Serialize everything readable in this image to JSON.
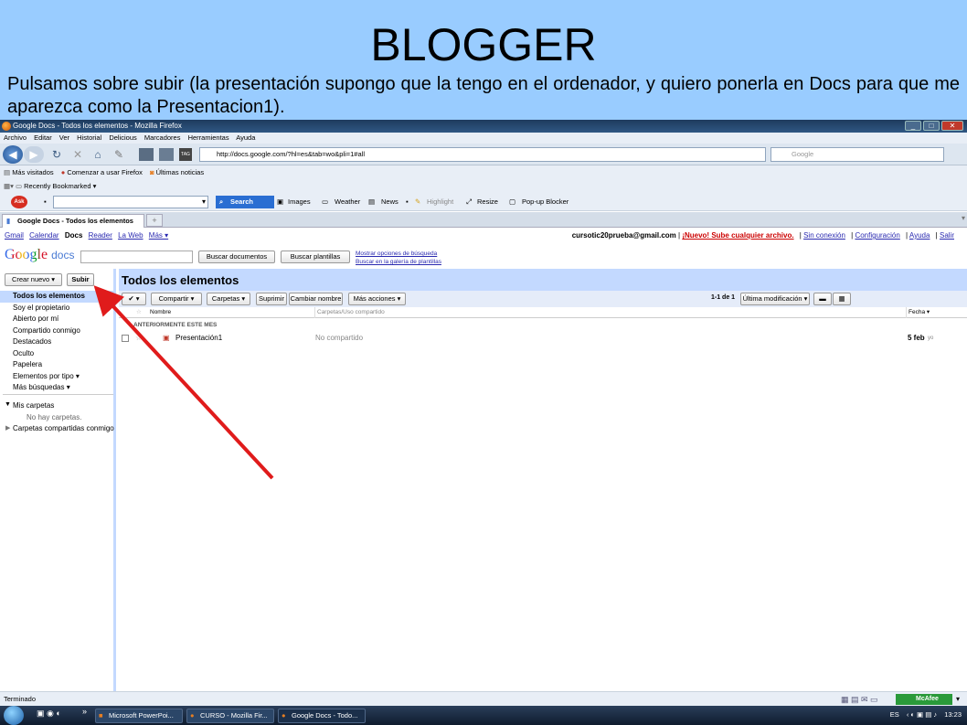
{
  "slide": {
    "title": "BLOGGER",
    "subtitle": "Pulsamos sobre subir (la presentación supongo que la tengo en el ordenador, y quiero ponerla en Docs para que me aparezca como la Presentacion1)."
  },
  "browser": {
    "window_title": "Google Docs - Todos los elementos - Mozilla Firefox",
    "menu": [
      "Archivo",
      "Editar",
      "Ver",
      "Historial",
      "Delicious",
      "Marcadores",
      "Herramientas",
      "Ayuda"
    ],
    "url": "http://docs.google.com/?hl=es&tab=wo&pli=1#all",
    "search_placeholder": "Google",
    "bookmarks": [
      "Más visitados",
      "Comenzar a usar Firefox",
      "Últimas noticias"
    ],
    "recently_bookmarked": "Recently Bookmarked",
    "ask_toolbar": {
      "search": "Search",
      "items": [
        "Images",
        "Weather",
        "News",
        "Highlight",
        "Resize",
        "Pop-up Blocker"
      ]
    },
    "tab_title": "Google Docs - Todos los elementos",
    "status": "Terminado",
    "mcafee": "McAfee"
  },
  "gbar": {
    "links": [
      "Gmail",
      "Calendar",
      "Docs",
      "Reader",
      "La Web",
      "Más ▾"
    ],
    "user": "cursotic20prueba@gmail.com",
    "new_link": "¡Nuevo! Sube cualquier archivo.",
    "right_links": [
      "Sin conexión",
      "Configuración",
      "Ayuda",
      "Salir"
    ]
  },
  "docs": {
    "logo_google": "Google",
    "logo_docs": "docs",
    "search_docs": "Buscar documentos",
    "search_templates": "Buscar plantillas",
    "link_options": "Mostrar opciones de búsqueda",
    "link_gallery": "Buscar en la galería de plantillas",
    "create_new": "Crear nuevo ▾",
    "upload": "Subir",
    "sidebar": [
      "Todos los elementos",
      "Soy el propietario",
      "Abierto por mí",
      "Compartido conmigo",
      "Destacados",
      "Oculto",
      "Papelera",
      "Elementos por tipo ▾",
      "Más búsquedas ▾"
    ],
    "my_folders": "Mis carpetas",
    "no_folders": "No hay carpetas.",
    "shared_folders": "Carpetas compartidas conmigo",
    "main_title": "Todos los elementos",
    "toolbar": [
      "Compartir ▾",
      "Carpetas ▾",
      "Suprimir",
      "Cambiar nombre",
      "Más acciones ▾"
    ],
    "pagination": "1-1 de 1",
    "sort": "Última modificación ▾",
    "col_name": "Nombre",
    "col_folders": "Carpetas/Uso compartido",
    "col_date": "Fecha ▾",
    "group": "ANTERIORMENTE ESTE MES",
    "row": {
      "name": "Presentación1",
      "sharing": "No compartido",
      "date": "5 feb",
      "by": "yo"
    }
  },
  "taskbar": {
    "tasks": [
      "Microsoft PowerPoi...",
      "CURSO - Mozilla Fir...",
      "Google Docs - Todo..."
    ],
    "lang": "ES",
    "time": "13:23"
  },
  "colors": {
    "slide_bg": "#99ccff",
    "docs_blue": "#c3d9ff",
    "arrow": "#e01b1b"
  }
}
